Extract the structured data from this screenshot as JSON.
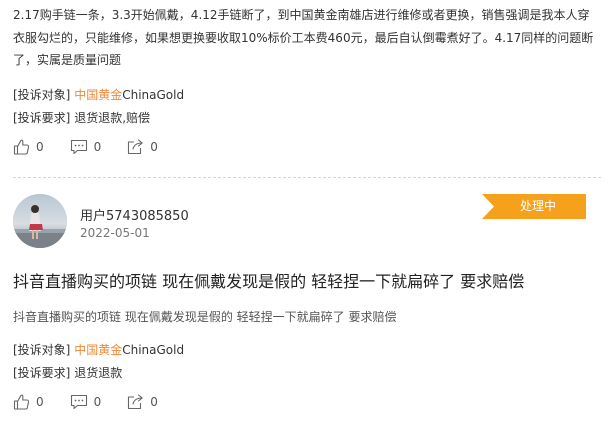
{
  "first_complaint": {
    "body": "2.17购手链一条，3.3开始佩戴，4.12手链断了，到中国黄金南雄店进行维修或者更换，销售强调是我本人穿衣服勾烂的，只能维修，如果想更换要收取10%标价工本费460元，最后自认倒霉煮好了。4.17同样的问题断了，实属是质量问题",
    "target_label": "[投诉对象]",
    "target_value": "中国黄金",
    "target_suffix": "ChinaGold",
    "demand_label": "[投诉要求]",
    "demand_value": "退货退款,赔偿",
    "likes": "0",
    "comments": "0",
    "shares": "0"
  },
  "second_complaint": {
    "username": "用户5743085850",
    "date": "2022-05-01",
    "status": "处理中",
    "title": "抖音直播购买的项链 现在佩戴发现是假的 轻轻捏一下就扁碎了 要求赔偿",
    "summary": "抖音直播购买的项链 现在佩戴发现是假的 轻轻捏一下就扁碎了 要求赔偿",
    "target_label": "[投诉对象]",
    "target_value": "中国黄金",
    "target_suffix": "ChinaGold",
    "demand_label": "[投诉要求]",
    "demand_value": "退货退款",
    "likes": "0",
    "comments": "0",
    "shares": "0"
  },
  "colors": {
    "accent_link": "#f0883a",
    "status_badge": "#f5a11c",
    "text": "#333333"
  },
  "icons": {
    "like": "thumbs-up-icon",
    "comment": "comment-icon",
    "share": "share-icon"
  }
}
